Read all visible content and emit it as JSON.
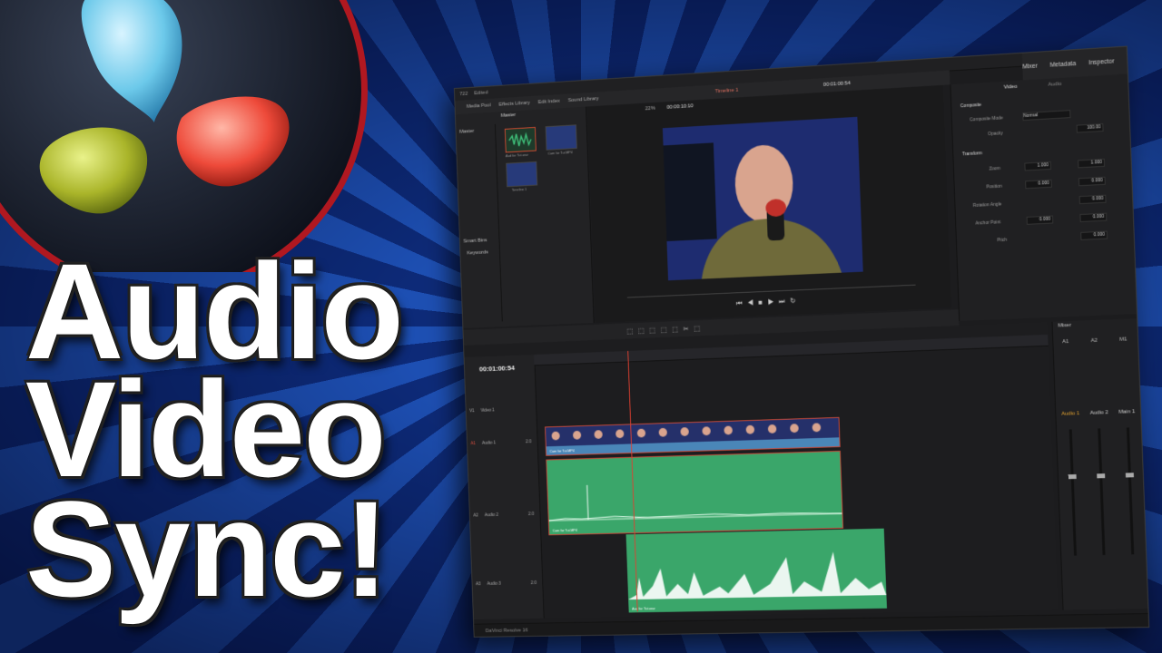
{
  "title": {
    "line1": "Audio",
    "line2": "Video",
    "line3": "Sync!"
  },
  "colors": {
    "background_blue": "#1d4fb3",
    "audio_clip_green": "#3aa66a",
    "video_clip_blue": "#4a86b8",
    "playhead_red": "#e04030"
  },
  "app": {
    "top_tabs": [
      "Mixer",
      "Metadata",
      "Inspector"
    ],
    "toolbar": [
      "Media Pool",
      "Effects Library",
      "Edit Index",
      "Sound Library"
    ],
    "project_name": "722",
    "project_status": "Edited",
    "timeline_name": "Timeline 1",
    "timecode_top": "00:01:00:54",
    "zoom": "22%",
    "viewer_timecode": "00:00:10:10",
    "media_pool": {
      "bin": "Master",
      "side_label": "Master",
      "smart_bins": "Smart Bins",
      "keywords": "Keywords",
      "clips": [
        "Aud for Tut.wav",
        "Cam for Tut.MP4",
        "Timeline 1"
      ]
    },
    "inspector": {
      "tabs": [
        "Video",
        "Audio"
      ],
      "composite_header": "Composite",
      "composite_mode_label": "Composite Mode",
      "composite_mode_value": "Normal",
      "opacity_label": "Opacity",
      "opacity_value": "100.00",
      "transform_header": "Transform",
      "zoom_label": "Zoom",
      "zoom_x": "1.000",
      "zoom_y": "1.000",
      "position_label": "Position",
      "position_x": "0.000",
      "position_y": "0.000",
      "rotation_label": "Rotation Angle",
      "rotation_value": "0.000",
      "anchor_label": "Anchor Point",
      "anchor_x": "0.000",
      "anchor_y": "0.000",
      "pitch_label": "Pitch",
      "pitch_value": "0.000"
    },
    "timeline": {
      "timecode": "00:01:00:54",
      "tracks": [
        {
          "id": "V1",
          "name": "Video 1"
        },
        {
          "id": "A1",
          "name": "Audio 1",
          "ch": "2.0"
        },
        {
          "id": "A2",
          "name": "Audio 2",
          "ch": "2.0"
        },
        {
          "id": "A3",
          "name": "Audio 3",
          "ch": "2.0"
        }
      ],
      "clip_video": "Cam for Tut.MP4",
      "clip_audio1": "Cam for Tut.MP4",
      "clip_audio2": "Aud for Tut.wav"
    },
    "mixer": {
      "title": "Mixer",
      "channels": [
        "A1",
        "A2",
        "M1"
      ],
      "buses": [
        "Audio 1",
        "Audio 2",
        "Main 1"
      ]
    },
    "status": {
      "app_name": "DaVinci Resolve 16"
    }
  }
}
